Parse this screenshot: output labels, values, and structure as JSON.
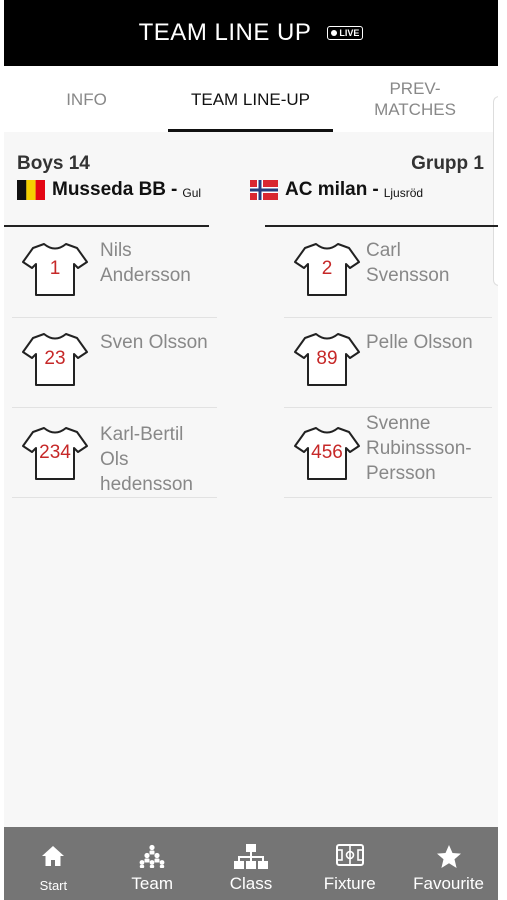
{
  "header": {
    "title": "TEAM LINE UP",
    "live_badge": "LIVE"
  },
  "tabs": [
    {
      "label": "INFO"
    },
    {
      "label": "TEAM LINE-UP"
    },
    {
      "label_line1": "PREV-",
      "label_line2": "MATCHES"
    }
  ],
  "match": {
    "class_name": "Boys 14",
    "group_name": "Grupp 1",
    "home": {
      "name": "Musseda BB",
      "separator": "-",
      "color": "Gul"
    },
    "away": {
      "name": "AC milan",
      "separator": "-",
      "color": "Ljusröd"
    }
  },
  "colors": {
    "shirt_number": "#c62828",
    "nav_bg": "#757575",
    "header_bg": "#000000"
  },
  "home_players": [
    {
      "number": "1",
      "line1": "Nils",
      "line2": "Andersson"
    },
    {
      "number": "23",
      "line1": "Sven Olsson"
    },
    {
      "number": "234",
      "line1": "Karl-Bertil Ols",
      "line2": "hedensson"
    }
  ],
  "away_players": [
    {
      "number": "2",
      "line1": "Carl",
      "line2": "Svensson"
    },
    {
      "number": "89",
      "line1": "Pelle Olsson"
    },
    {
      "number": "456",
      "line1": "Svenne",
      "line2": "Rubinssson-",
      "line3": "Persson"
    }
  ],
  "nav": [
    {
      "label": "Start",
      "icon": "home-icon"
    },
    {
      "label": "Team",
      "icon": "team-icon"
    },
    {
      "label": "Class",
      "icon": "hierarchy-icon"
    },
    {
      "label": "Fixture",
      "icon": "field-icon"
    },
    {
      "label": "Favourite",
      "icon": "star-icon"
    }
  ]
}
